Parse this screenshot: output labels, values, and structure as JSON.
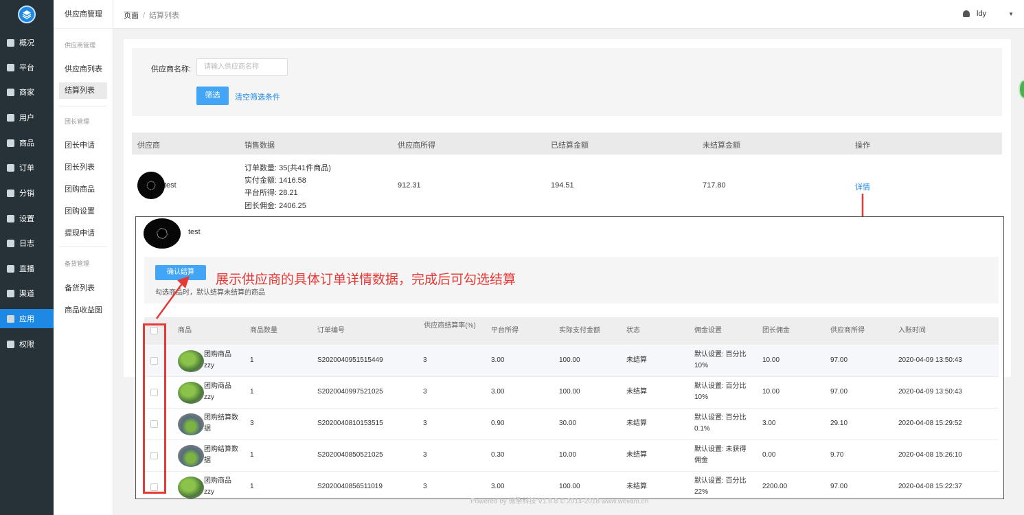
{
  "nav": {
    "items": [
      {
        "label": "概况",
        "icon": "dashboard-icon"
      },
      {
        "label": "平台",
        "icon": "monitor-icon"
      },
      {
        "label": "商家",
        "icon": "store-icon"
      },
      {
        "label": "用户",
        "icon": "user-icon"
      },
      {
        "label": "商品",
        "icon": "goods-icon"
      },
      {
        "label": "订单",
        "icon": "order-icon"
      },
      {
        "label": "分销",
        "icon": "distribution-icon"
      },
      {
        "label": "设置",
        "icon": "gear-icon"
      },
      {
        "label": "日志",
        "icon": "log-icon"
      },
      {
        "label": "直播",
        "icon": "live-icon"
      },
      {
        "label": "渠道",
        "icon": "channel-icon"
      },
      {
        "label": "应用",
        "icon": "apps-icon"
      },
      {
        "label": "权限",
        "icon": "lock-icon"
      }
    ],
    "active": "应用"
  },
  "subnav": {
    "title": "供应商管理",
    "groups": [
      "供应商管理",
      "团长管理",
      "备货管理"
    ],
    "items": [
      "供应商列表",
      "结算列表",
      "团长申请",
      "团长列表",
      "团购商品",
      "团购设置",
      "提现申请",
      "备货列表",
      "商品收益图"
    ]
  },
  "topbar": {
    "crumb_root": "页面",
    "crumb_sep": "/",
    "crumb_current": "结算列表",
    "user_name": "ldy",
    "caret": "▼"
  },
  "filter": {
    "label": "供应商名称:",
    "placeholder": "请输入供应商名称",
    "submit": "筛选",
    "clear": "清空筛选条件"
  },
  "table": {
    "headers": [
      "供应商",
      "销售数据",
      "供应商所得",
      "已结算金额",
      "未结算金额",
      "操作"
    ],
    "row": {
      "supplier": "test",
      "sales": [
        "订单数量: 35(共41件商品)",
        "实付金额: 1416.58",
        "平台所得: 28.21",
        "团长佣金: 2406.25"
      ],
      "supplier_income": "912.31",
      "settled": "194.51",
      "unsettled": "717.80",
      "action": "详情"
    }
  },
  "detail": {
    "supplier": "test",
    "confirm": "确认结算",
    "hint": "勾选商品时，默认结算未结算的商品",
    "annotation": "展示供应商的具体订单详情数据，完成后可勾选结算",
    "headers": [
      "商品",
      "商品数量",
      "订单编号",
      "供应商结算率(%)",
      "平台所得",
      "实际支付金额",
      "状态",
      "佣金设置",
      "团长佣金",
      "供应商所得",
      "入账时间"
    ],
    "rows": [
      {
        "name": "团购商品zzy",
        "qty": "1",
        "order": "S2020040951515449",
        "rate": "3",
        "platform": "3.00",
        "paid": "100.00",
        "status": "未结算",
        "commission": "默认设置: 百分比10%",
        "leader": "10.00",
        "income": "97.00",
        "time": "2020-04-09 13:50:43"
      },
      {
        "name": "团购商品zzy",
        "qty": "1",
        "order": "S2020040997521025",
        "rate": "3",
        "platform": "3.00",
        "paid": "100.00",
        "status": "未结算",
        "commission": "默认设置: 百分比10%",
        "leader": "10.00",
        "income": "97.00",
        "time": "2020-04-09 13:50:43"
      },
      {
        "name": "团购结算数据",
        "qty": "3",
        "order": "S2020040810153515",
        "rate": "3",
        "platform": "0.90",
        "paid": "30.00",
        "status": "未结算",
        "commission": "默认设置: 百分比0.1%",
        "leader": "3.00",
        "income": "29.10",
        "time": "2020-04-08 15:29:52"
      },
      {
        "name": "团购结算数据",
        "qty": "1",
        "order": "S2020040850521025",
        "rate": "3",
        "platform": "0.30",
        "paid": "10.00",
        "status": "未结算",
        "commission": "默认设置: 未获得佣金",
        "leader": "0.00",
        "income": "9.70",
        "time": "2020-04-08 15:26:10"
      },
      {
        "name": "团购商品zzy",
        "qty": "1",
        "order": "S2020040856511019",
        "rate": "3",
        "platform": "3.00",
        "paid": "100.00",
        "status": "未结算",
        "commission": "默认设置: 百分比22%",
        "leader": "2200.00",
        "income": "97.00",
        "time": "2020-04-08 15:22:37"
      }
    ]
  },
  "footer": "Powered by 微擎科技 V1.8.8 © 2014-2018 www.weiiam.cn",
  "colors": {
    "accent": "#42a5f5",
    "sidebar": "#263238",
    "annotation": "#e53935"
  }
}
